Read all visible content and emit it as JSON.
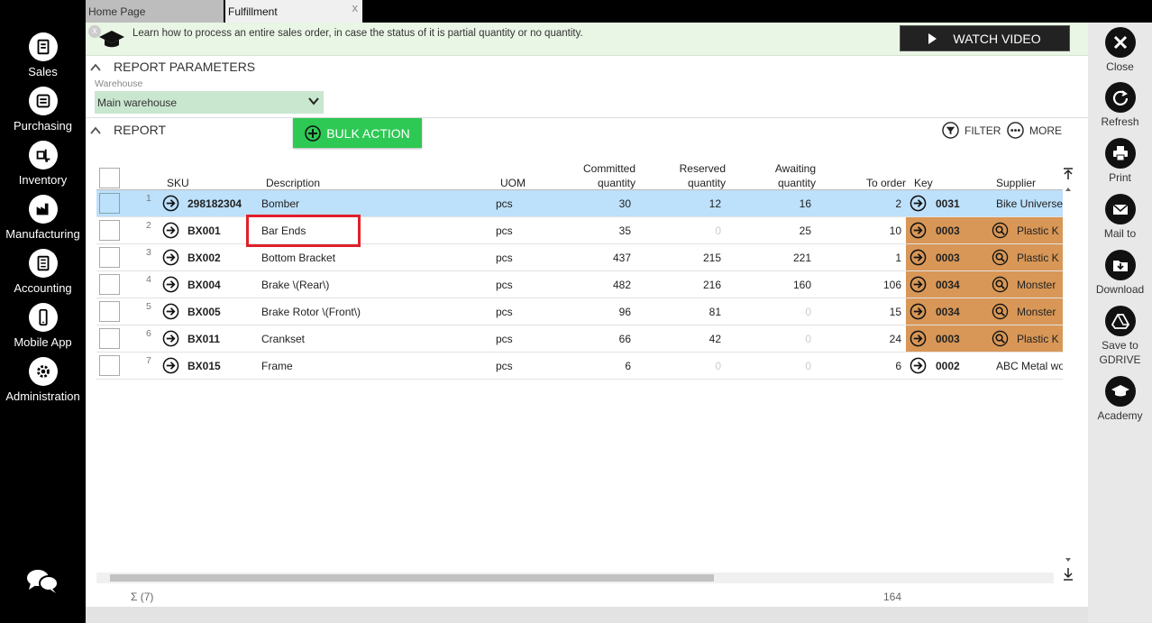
{
  "tabs": [
    {
      "label": "Home Page"
    },
    {
      "label": "Fulfillment"
    }
  ],
  "tab_close": "x",
  "leftnav": [
    {
      "label": "Sales",
      "icon": "sales-icon"
    },
    {
      "label": "Purchasing",
      "icon": "purchasing-icon"
    },
    {
      "label": "Inventory",
      "icon": "inventory-icon"
    },
    {
      "label": "Manufacturing",
      "icon": "manufacturing-icon"
    },
    {
      "label": "Accounting",
      "icon": "accounting-icon"
    },
    {
      "label": "Mobile App",
      "icon": "mobile-icon"
    },
    {
      "label": "Administration",
      "icon": "gear-icon"
    }
  ],
  "rightbar": [
    {
      "label": "Close"
    },
    {
      "label": "Refresh"
    },
    {
      "label": "Print"
    },
    {
      "label": "Mail to"
    },
    {
      "label": "Download"
    },
    {
      "label": "Save to GDRIVE"
    },
    {
      "label": "Academy"
    }
  ],
  "banner": {
    "close": "x",
    "text": "Learn how to process an entire sales order, in case the status of it is partial quantity or no quantity.",
    "watch_video": "WATCH VIDEO"
  },
  "report_parameters": {
    "title": "REPORT PARAMETERS",
    "warehouse_label": "Warehouse",
    "warehouse_value": "Main warehouse"
  },
  "report": {
    "title": "REPORT",
    "bulk_action": "BULK ACTION",
    "filter": "FILTER",
    "more": "MORE"
  },
  "table": {
    "headers": {
      "sku": "SKU",
      "description": "Description",
      "uom": "UOM",
      "committed": [
        "Committed",
        "quantity"
      ],
      "reserved": [
        "Reserved",
        "quantity"
      ],
      "awaiting": [
        "Awaiting",
        "quantity"
      ],
      "to_order": "To order",
      "key": "Key",
      "supplier": "Supplier"
    },
    "rows": [
      {
        "n": "1",
        "sku": "298182304",
        "desc": "Bomber",
        "uom": "pcs",
        "committed": "30",
        "reserved": "12",
        "awaiting": "16",
        "to_order": "2",
        "key": "0031",
        "supplier": "Bike Universe"
      },
      {
        "n": "2",
        "sku": "BX001",
        "desc": "Bar Ends",
        "uom": "pcs",
        "committed": "35",
        "reserved": "0",
        "awaiting": "25",
        "to_order": "10",
        "key": "0003",
        "supplier": "Plastic K"
      },
      {
        "n": "3",
        "sku": "BX002",
        "desc": "Bottom Bracket",
        "uom": "pcs",
        "committed": "437",
        "reserved": "215",
        "awaiting": "221",
        "to_order": "1",
        "key": "0003",
        "supplier": "Plastic K"
      },
      {
        "n": "4",
        "sku": "BX004",
        "desc": "Brake \\(Rear\\)",
        "uom": "pcs",
        "committed": "482",
        "reserved": "216",
        "awaiting": "160",
        "to_order": "106",
        "key": "0034",
        "supplier": "Monster"
      },
      {
        "n": "5",
        "sku": "BX005",
        "desc": "Brake Rotor \\(Front\\)",
        "uom": "pcs",
        "committed": "96",
        "reserved": "81",
        "awaiting": "0",
        "to_order": "15",
        "key": "0034",
        "supplier": "Monster"
      },
      {
        "n": "6",
        "sku": "BX011",
        "desc": "Crankset",
        "uom": "pcs",
        "committed": "66",
        "reserved": "42",
        "awaiting": "0",
        "to_order": "24",
        "key": "0003",
        "supplier": "Plastic K"
      },
      {
        "n": "7",
        "sku": "BX015",
        "desc": "Frame",
        "uom": "pcs",
        "committed": "6",
        "reserved": "0",
        "awaiting": "0",
        "to_order": "6",
        "key": "0002",
        "supplier": "ABC Metal wo"
      }
    ]
  },
  "footer": {
    "count": "Σ (7)",
    "total": "164"
  },
  "colors": {
    "accent_green": "#2ec854",
    "selected_row": "#bde0fb",
    "key_orange": "#d89757",
    "highlight_box": "#e0202a"
  }
}
